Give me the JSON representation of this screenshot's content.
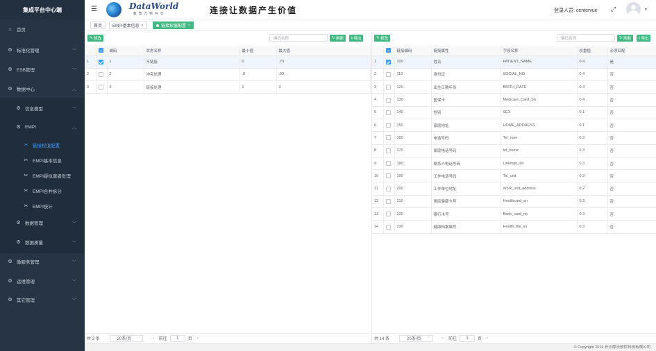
{
  "app": {
    "brand": "集成平台中心端",
    "slogan": "连接让数据产生价值",
    "logo_text": "DataWorld",
    "logo_sub": "数 慧 万 物 共 享",
    "login_label": "登录人员: centervue",
    "footer": "© Copyright 2016 长沙厚沃软件科技有限公司"
  },
  "sidebar": {
    "items": [
      {
        "label": "首页",
        "icon": "home-icon"
      },
      {
        "label": "标准化管理",
        "icon": "gear-icon"
      },
      {
        "label": "ESB管理",
        "icon": "gear-icon"
      },
      {
        "label": "数据中心",
        "icon": "gear-icon"
      },
      {
        "label": "信息模型",
        "icon": "gear-icon"
      },
      {
        "label": "EMPI",
        "icon": "gear-icon"
      },
      {
        "label": "链接权值配置",
        "icon": "wrench-icon"
      },
      {
        "label": "EMPI基本信息",
        "icon": "wrench-icon"
      },
      {
        "label": "EMPI疑似患者处理",
        "icon": "wrench-icon"
      },
      {
        "label": "EMPI合并拆分",
        "icon": "wrench-icon"
      },
      {
        "label": "EMPI统计",
        "icon": "wrench-icon"
      },
      {
        "label": "数据管理",
        "icon": "gear-icon"
      },
      {
        "label": "数据质量",
        "icon": "gear-icon"
      },
      {
        "label": "微服务管理",
        "icon": "gear-icon"
      },
      {
        "label": "运维管理",
        "icon": "gear-icon"
      },
      {
        "label": "其它管理",
        "icon": "gear-icon"
      }
    ]
  },
  "tabs": [
    {
      "label": "首页"
    },
    {
      "label": "EMPI基本信息"
    },
    {
      "label": "链接权值配置"
    }
  ],
  "left": {
    "edit_label": "修改",
    "search_placeholder": "编码名称",
    "refresh_label": "刷新",
    "export_label": "导出",
    "columns": [
      "编码",
      "状态名称",
      "最小值",
      "最大值"
    ],
    "rows": [
      {
        "n": "1",
        "code": "1",
        "name": "不链接",
        "min": "0",
        "max": ".79"
      },
      {
        "n": "2",
        "code": "2",
        "name": "冲突处理",
        "min": ".8",
        "max": ".99"
      },
      {
        "n": "3",
        "code": "3",
        "name": "链接处理",
        "min": "1",
        "max": "3"
      }
    ],
    "total": "共 3 条",
    "page_size": "20条/页",
    "goto": "前往",
    "page": "1",
    "page_unit": "页"
  },
  "right": {
    "edit_label": "修改",
    "search_placeholder": "编码名称",
    "refresh_label": "刷新",
    "export_label": "导出",
    "columns": [
      "链接编码",
      "链接属性",
      "字段名称",
      "权重值",
      "必须匹配"
    ],
    "rows": [
      {
        "n": "1",
        "code": "100",
        "attr": "姓名",
        "field": "PATIENT_NAME",
        "w": "0.4",
        "req": "是"
      },
      {
        "n": "2",
        "code": "110",
        "attr": "身份证",
        "field": "SOCIAL_NO",
        "w": "0.4",
        "req": "否"
      },
      {
        "n": "3",
        "code": "120",
        "attr": "出生日期年份",
        "field": "BRITH_DATE",
        "w": "0.4",
        "req": "否"
      },
      {
        "n": "4",
        "code": "130",
        "attr": "医保卡",
        "field": "Medicare_Card_Sn",
        "w": "0.4",
        "req": "否"
      },
      {
        "n": "5",
        "code": "140",
        "attr": "性别",
        "field": "SEX",
        "w": "0.1",
        "req": "否"
      },
      {
        "n": "6",
        "code": "150",
        "attr": "家庭地址",
        "field": "HOME_ADDRESS",
        "w": "0.1",
        "req": "否"
      },
      {
        "n": "7",
        "code": "160",
        "attr": "电话号码",
        "field": "Tel_num",
        "w": "0.3",
        "req": "否"
      },
      {
        "n": "8",
        "code": "170",
        "attr": "家庭电话号码",
        "field": "tel_home",
        "w": "0.3",
        "req": "否"
      },
      {
        "n": "9",
        "code": "180",
        "attr": "联系人电话号码",
        "field": "Linkman_tel",
        "w": "0.3",
        "req": "否"
      },
      {
        "n": "10",
        "code": "190",
        "attr": "工作电话号码",
        "field": "Tel_unit",
        "w": "0.2",
        "req": "否"
      },
      {
        "n": "11",
        "code": "200",
        "attr": "工作单位地址",
        "field": "Work_unit_address",
        "w": "0.2",
        "req": "否"
      },
      {
        "n": "12",
        "code": "210",
        "attr": "居民健康卡号",
        "field": "Healthcard_sn",
        "w": "0.3",
        "req": "否"
      },
      {
        "n": "13",
        "code": "220",
        "attr": "银行卡号",
        "field": "Bank_card_no",
        "w": "0.3",
        "req": "否"
      },
      {
        "n": "14",
        "code": "230",
        "attr": "健康档案编号",
        "field": "Health_file_sn",
        "w": "0.3",
        "req": "否"
      }
    ],
    "total": "共 14 条",
    "page_size": "20条/页",
    "goto": "前往",
    "page": "1",
    "page_unit": "页"
  }
}
